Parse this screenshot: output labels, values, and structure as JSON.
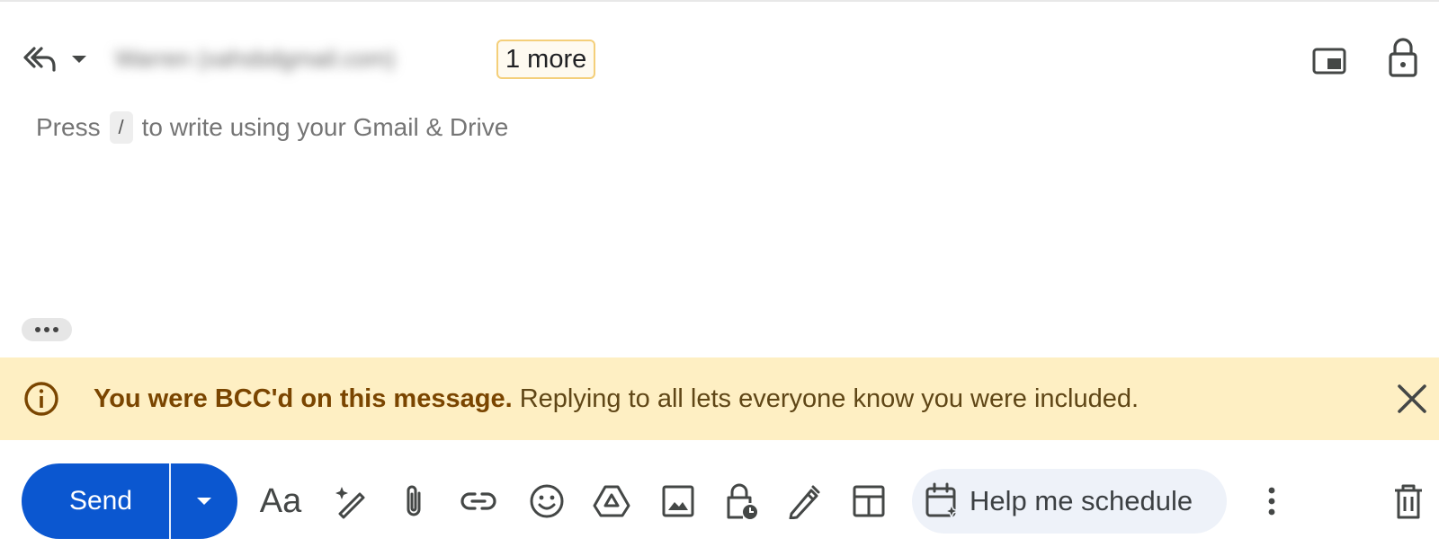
{
  "compose": {
    "reply_menu": {
      "icon": "reply-all-icon",
      "dropdown_icon": "caret-down-icon"
    },
    "recipient": {
      "text": "Warren (xahsbdgmail.com)",
      "note": "blurred"
    },
    "more_recipients": "1 more",
    "header_icons": [
      "pop-out-icon",
      "lock-icon"
    ],
    "body": {
      "placeholder_before": "Press",
      "placeholder_key": "/",
      "placeholder_after": "to write using your Gmail & Drive"
    }
  },
  "banner": {
    "icon": "info-icon",
    "bold_text": "You were BCC'd on this message.",
    "text": "Replying to all lets everyone know you were included.",
    "close_icon": "close-icon",
    "bg_color": "#feefc3"
  },
  "toolbar": {
    "send_label": "Send",
    "send_color": "#0b57d0",
    "format_label": "Aa",
    "icons": [
      "formatting-options-icon",
      "magic-write-icon",
      "attach-icon",
      "link-icon",
      "emoji-icon",
      "drive-icon",
      "photo-icon",
      "confidential-mode-icon",
      "signature-icon",
      "layouts-icon"
    ],
    "schedule_label": "Help me schedule",
    "more_icon": "more-vert-icon",
    "discard_icon": "trash-icon"
  }
}
